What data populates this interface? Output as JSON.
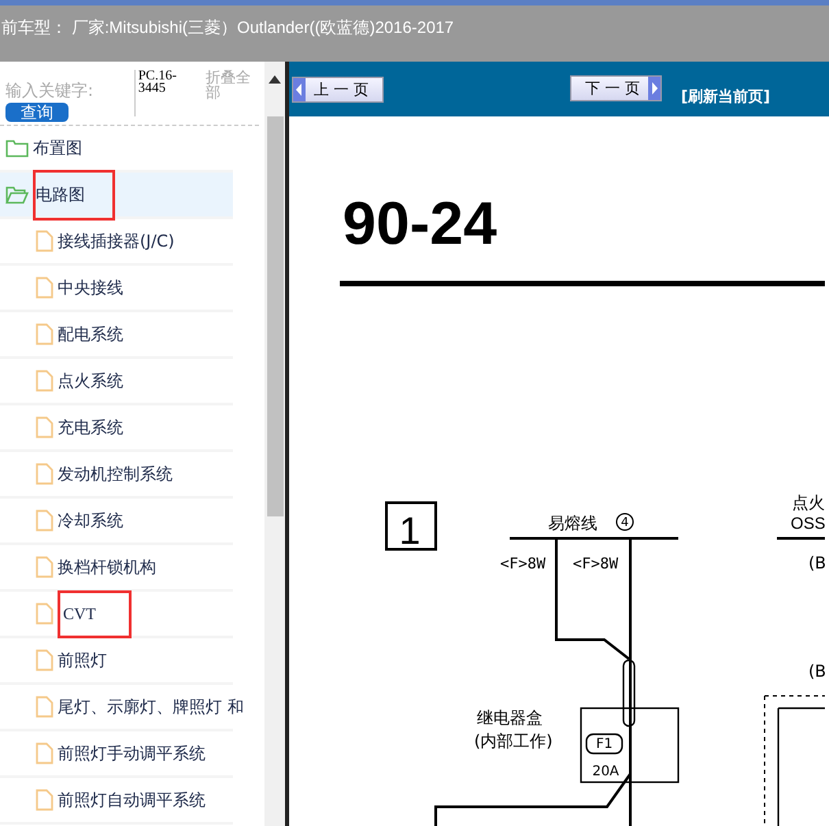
{
  "header": {
    "title": "前车型：  厂家:Mitsubishi(三菱）Outlander((欧蓝德)2016-2017"
  },
  "search": {
    "label": "输入关键字:",
    "button": "查询",
    "code": "PC.16-3445",
    "collapse": "折叠全部"
  },
  "tree": [
    {
      "label": "布置图",
      "expanded": false,
      "selected": false,
      "highlighted": false
    },
    {
      "label": "电路图",
      "expanded": true,
      "selected": true,
      "highlighted": true,
      "children": [
        {
          "label": "接线插接器(J/C)",
          "highlighted": false
        },
        {
          "label": "中央接线",
          "highlighted": false
        },
        {
          "label": "配电系统",
          "highlighted": false
        },
        {
          "label": "点火系统",
          "highlighted": false
        },
        {
          "label": "充电系统",
          "highlighted": false
        },
        {
          "label": "发动机控制系统",
          "highlighted": false
        },
        {
          "label": "冷却系统",
          "highlighted": false
        },
        {
          "label": "换档杆锁机构",
          "highlighted": false
        },
        {
          "label": "CVT",
          "highlighted": true
        },
        {
          "label": "前照灯",
          "highlighted": false
        },
        {
          "label": "尾灯、示廓灯、牌照灯 和",
          "highlighted": false
        },
        {
          "label": "前照灯手动调平系统",
          "highlighted": false
        },
        {
          "label": "前照灯自动调平系统",
          "highlighted": false
        }
      ]
    }
  ],
  "nav": {
    "prev": "上 一 页",
    "next": "下 一 页",
    "refresh": "[刷新当前页]"
  },
  "document": {
    "page_number": "90-24",
    "labels": [
      "1",
      "易熔线",
      "4",
      "<F>8W",
      "<F>8W",
      "点火",
      "OSS",
      "(B",
      "(B",
      "继电器盒",
      "(内部工作)",
      "F1",
      "20A"
    ]
  }
}
